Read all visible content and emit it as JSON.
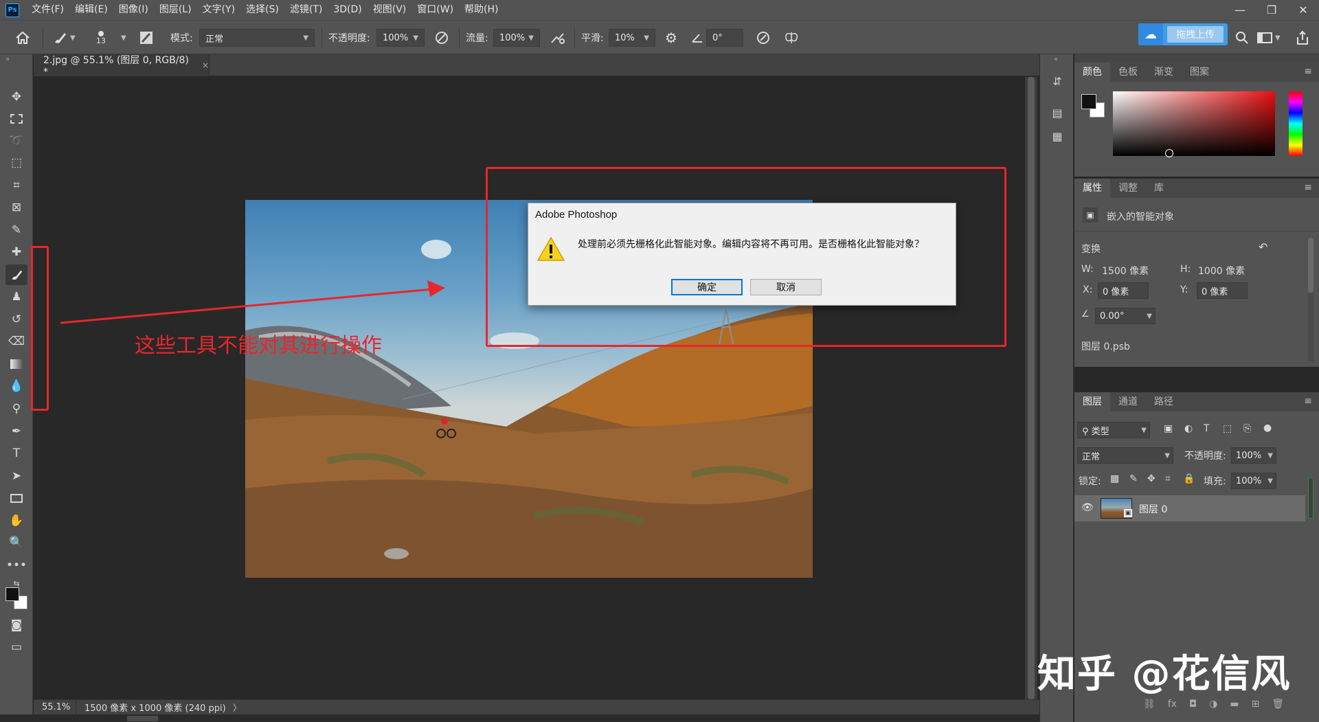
{
  "app": {
    "logo": "Ps"
  },
  "menu": [
    "文件(F)",
    "编辑(E)",
    "图像(I)",
    "图层(L)",
    "文字(Y)",
    "选择(S)",
    "滤镜(T)",
    "3D(D)",
    "视图(V)",
    "窗口(W)",
    "帮助(H)"
  ],
  "window_controls": {
    "minimize": "—",
    "restore": "❐",
    "close": "✕"
  },
  "options": {
    "brush_size": "13",
    "mode_label": "模式:",
    "mode_value": "正常",
    "opacity_label": "不透明度:",
    "opacity_value": "100%",
    "flow_label": "流量:",
    "flow_value": "100%",
    "smoothing_label": "平滑:",
    "smoothing_value": "10%",
    "angle_value": "0°",
    "upload_label": "拖拽上传"
  },
  "document": {
    "tab_title": "2.jpg @ 55.1% (图层 0, RGB/8) *",
    "tab_close": "×",
    "status_zoom": "55.1%",
    "status_info": "1500 像素 x 1000 像素 (240 ppi)",
    "status_arrow": "〉"
  },
  "dialog": {
    "title": "Adobe Photoshop",
    "message": "处理前必须先栅格化此智能对象。编辑内容将不再可用。是否栅格化此智能对象？",
    "ok": "确定",
    "cancel": "取消"
  },
  "annotation": {
    "text": "这些工具不能对其进行操作",
    "color": "#e8262b"
  },
  "color_panel": {
    "tabs": [
      "颜色",
      "色板",
      "渐变",
      "图案"
    ],
    "active_tab": 0
  },
  "properties_panel": {
    "tabs": [
      "属性",
      "调整",
      "库"
    ],
    "header": "嵌入的智能对象",
    "transform_label": "变换",
    "w_label": "W:",
    "w_value": "1500 像素",
    "h_label": "H:",
    "h_value": "1000 像素",
    "x_label": "X:",
    "x_value": "0 像素",
    "y_label": "Y:",
    "y_value": "0 像素",
    "angle_value": "0.00°",
    "file_name": "图层 0.psb"
  },
  "layers_panel": {
    "tabs": [
      "图层",
      "通道",
      "路径"
    ],
    "filter_label": "类型",
    "blend_mode": "正常",
    "opacity_label": "不透明度:",
    "opacity_value": "100%",
    "lock_label": "锁定:",
    "fill_label": "填充:",
    "fill_value": "100%",
    "layer_name": "图层 0"
  },
  "watermark": "知乎 @花信风",
  "colors": {
    "accent": "#31a8ff",
    "annotation_red": "#e8262b",
    "panel_bg": "#535353",
    "canvas_bg": "#282828"
  }
}
